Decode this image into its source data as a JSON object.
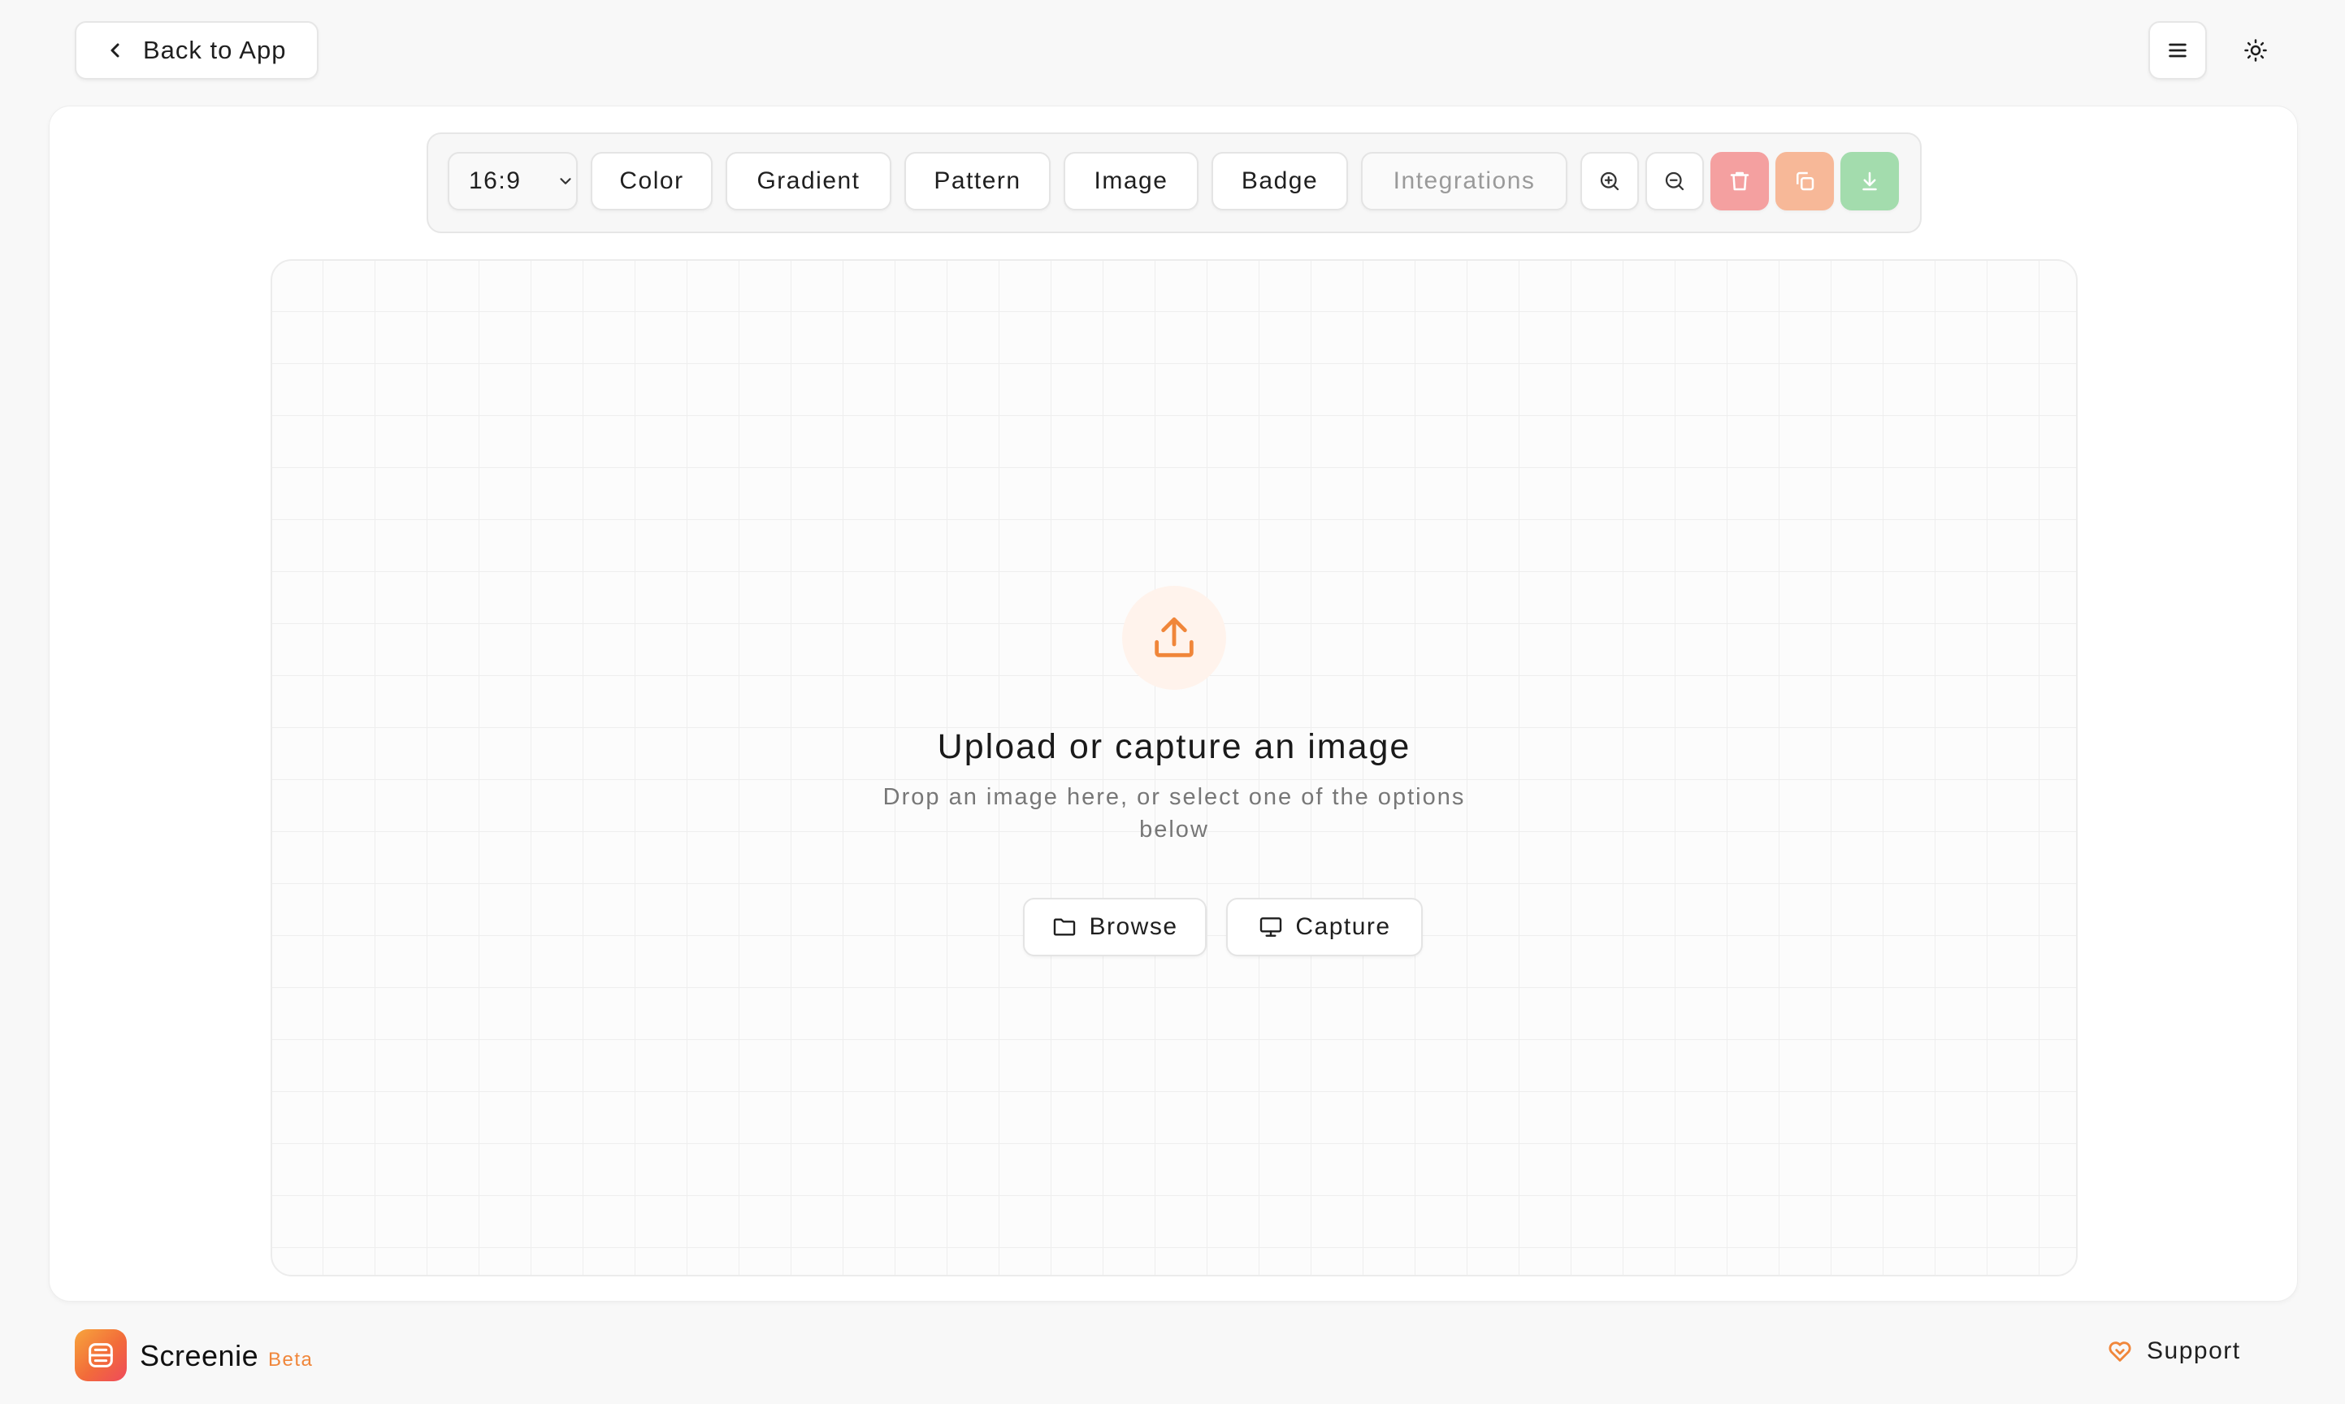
{
  "header": {
    "back_label": "Back to App",
    "back_icon": "chevron-left-icon",
    "menu_icon": "hamburger-menu-icon",
    "theme_icon": "sun-icon"
  },
  "toolbar": {
    "aspect_ratio": "16:9",
    "color_label": "Color",
    "gradient_label": "Gradient",
    "pattern_label": "Pattern",
    "image_label": "Image",
    "badge_label": "Badge",
    "integrations_label": "Integrations",
    "icons": [
      "zoom-in-icon",
      "zoom-out-icon",
      "trash-icon",
      "copy-icon",
      "download-icon"
    ]
  },
  "canvas": {
    "title": "Upload or capture an image",
    "subtitle": "Drop an image here, or select one of the options below",
    "browse_label": "Browse",
    "capture_label": "Capture"
  },
  "footer": {
    "brand": "Screenie",
    "beta": "Beta",
    "support_label": "Support"
  },
  "colors": {
    "accent": "#f0863a",
    "delete": "#f4a0a0",
    "copy": "#f7b898",
    "download": "#a3dcad"
  }
}
